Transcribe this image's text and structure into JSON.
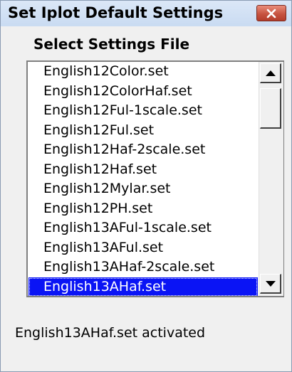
{
  "window": {
    "title": "Set Iplot Default Settings"
  },
  "section_label": "Select Settings File",
  "settings_files": [
    "English12Color.set",
    "English12ColorHaf.set",
    "English12Ful-1scale.set",
    "English12Ful.set",
    "English12Haf-2scale.set",
    "English12Haf.set",
    "English12Mylar.set",
    "English12PH.set",
    "English13AFul-1scale.set",
    "English13AFul.set",
    "English13AHaf-2scale.set",
    "English13AHaf.set"
  ],
  "selected_file": "English13AHaf.set",
  "status_text": "English13AHaf.set activated",
  "colors": {
    "selection": "#0a14f5",
    "close_button": "#c75441"
  },
  "icons": {
    "close": "close-icon",
    "scroll_up": "scroll-up-arrow-icon",
    "scroll_down": "scroll-down-arrow-icon"
  }
}
